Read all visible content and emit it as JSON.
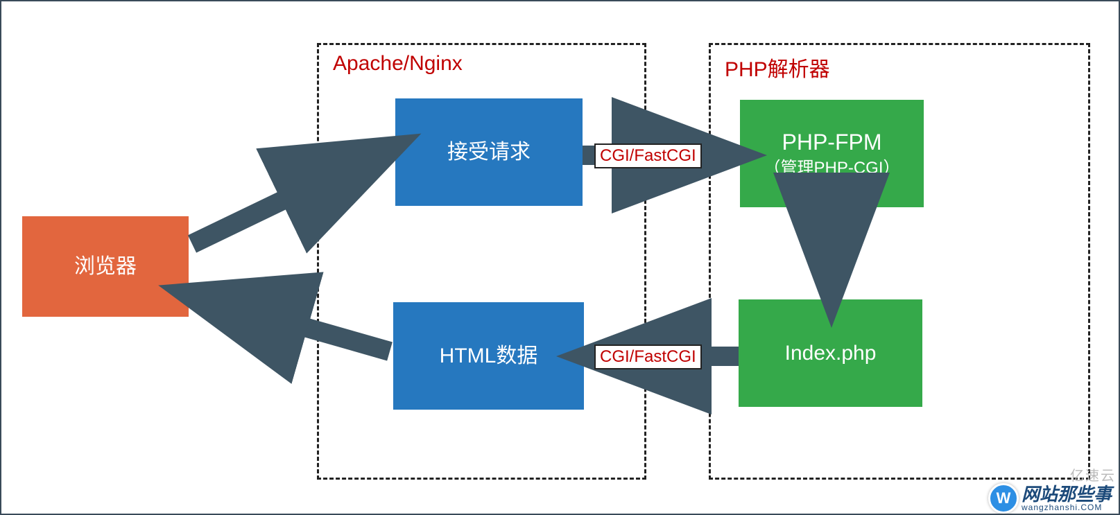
{
  "browser": {
    "label": "浏览器"
  },
  "apacheGroup": {
    "title": "Apache/Nginx",
    "request": "接受请求",
    "response": "HTML数据"
  },
  "phpGroup": {
    "title": "PHP解析器",
    "fpm_line1": "PHP-FPM",
    "fpm_line2": "（管理PHP-CGI）",
    "index": "Index.php"
  },
  "edgeLabels": {
    "cgi_top": "CGI/FastCGI",
    "cgi_bottom": "CGI/FastCGI"
  },
  "watermark": "亿速云",
  "logo": {
    "badge": "W",
    "cn": "网站那些事",
    "en": "wangzhanshi.COM"
  },
  "colors": {
    "orange": "#e2663e",
    "blue": "#2678bf",
    "green": "#35a94a",
    "arrow": "#3e5564",
    "labelRed": "#c00000"
  }
}
